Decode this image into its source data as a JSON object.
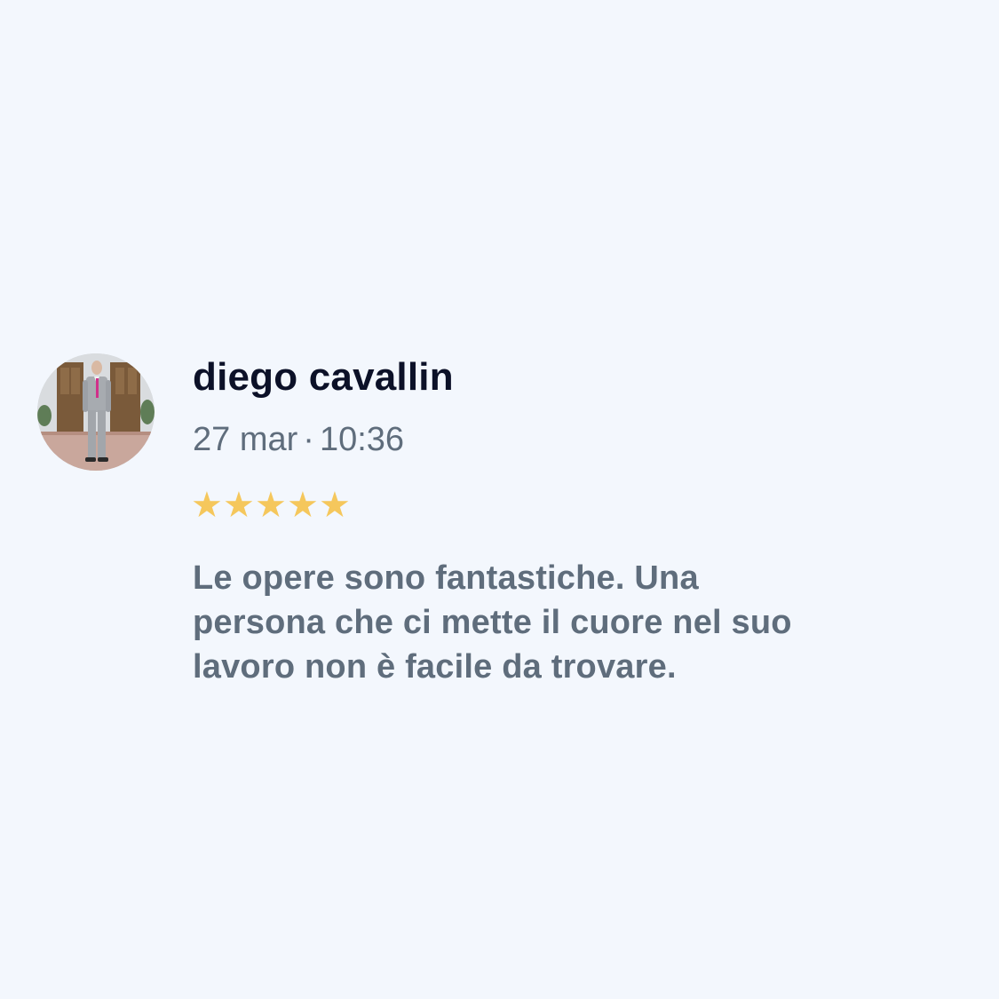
{
  "review": {
    "author": "diego cavallin",
    "date": "27 mar",
    "separator": "·",
    "time": "10:36",
    "rating": 5,
    "rating_max": 5,
    "star_glyph": "★",
    "star_color": "#f5c75c",
    "avatar_icon": "user-photo-avatar",
    "text": "Le opere sono fantastiche. Una persona che ci mette il cuore nel suo lavoro non è facile da trovare."
  }
}
